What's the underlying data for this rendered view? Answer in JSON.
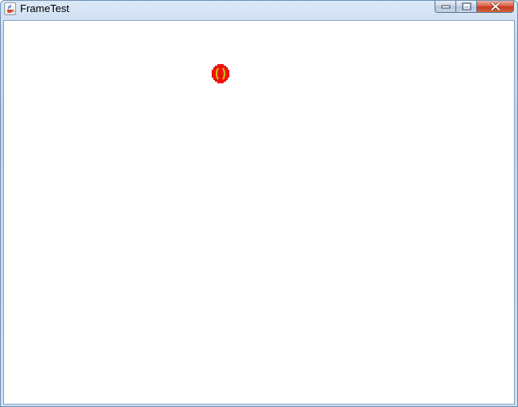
{
  "window": {
    "title": "FrameTest",
    "app_icon": "java-cup-icon",
    "controls": {
      "minimize_icon": "minimize-icon",
      "maximize_icon": "maximize-icon",
      "close_icon": "close-icon"
    }
  },
  "canvas": {
    "background": "#ffffff",
    "sprite": {
      "icon": "ball-icon",
      "fill_color": "#ee1111",
      "seam_color": "#c8c800"
    }
  },
  "colors": {
    "titlebar": "#c9dcf1",
    "close_button": "#c73a1c"
  }
}
